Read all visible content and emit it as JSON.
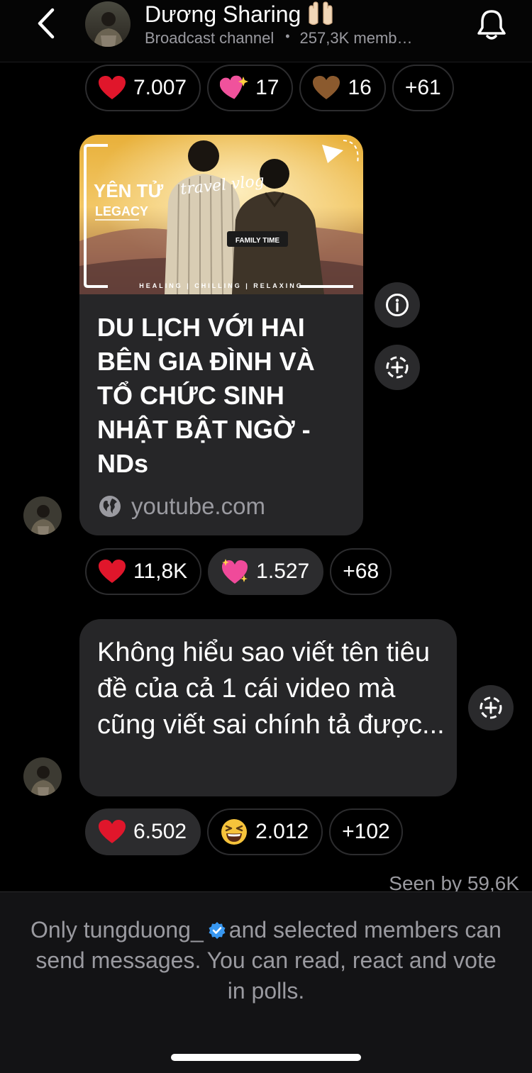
{
  "header": {
    "back_icon": "chevron-left-icon",
    "channel_name": "Dương Sharing",
    "channel_emoji": "raised-hands-emoji",
    "subtitle": "Broadcast channel",
    "separator": "•",
    "members": "257,3K memb…",
    "bell_icon": "bell-icon"
  },
  "reactions_1": [
    {
      "emoji": "red-heart-emoji",
      "count": "7.007"
    },
    {
      "emoji": "heart-with-sparkles-pink-emoji",
      "count": "17"
    },
    {
      "emoji": "brown-heart-emoji",
      "count": "16"
    },
    {
      "emoji": "",
      "count": "+61"
    }
  ],
  "link_card": {
    "thumbnail": {
      "title_line1": "YÊN TỬ",
      "title_line2": "LEGACY",
      "script_text": "travel vlog",
      "badge": "FAMILY TIME",
      "tagline": "HEALING | CHILLING | RELAXING"
    },
    "title": "DU LỊCH VỚI HAI BÊN GIA ĐÌNH VÀ TỔ CHỨC SINH NHẬT BẬT NGỜ - NDs",
    "domain": "youtube.com",
    "globe_icon": "globe-icon"
  },
  "reactions_2": [
    {
      "emoji": "red-heart-emoji",
      "count": "11,8K",
      "active": false
    },
    {
      "emoji": "sparkling-heart-emoji",
      "count": "1.527",
      "active": true
    },
    {
      "emoji": "",
      "count": "+68",
      "active": false
    }
  ],
  "message": {
    "text": "Không hiểu sao viết tên tiêu đề của cả 1 cái video mà cũng viết sai chính tả được..."
  },
  "reactions_3": [
    {
      "emoji": "red-heart-emoji",
      "count": "6.502",
      "active": true
    },
    {
      "emoji": "grinning-squinting-face-emoji",
      "count": "2.012",
      "active": false
    },
    {
      "emoji": "",
      "count": "+102",
      "active": false
    }
  ],
  "seen": "Seen by 59,6K",
  "footer": {
    "text_before": "Only tungduong_",
    "verified_icon": "verified-badge-icon",
    "text_after": "and selected members can send messages. You can read, react and vote in polls."
  },
  "colors": {
    "background": "#000000",
    "bubble": "#262628",
    "secondary_text": "#9a9aa0",
    "verified": "#3897f0",
    "heart": "#e0162b"
  }
}
